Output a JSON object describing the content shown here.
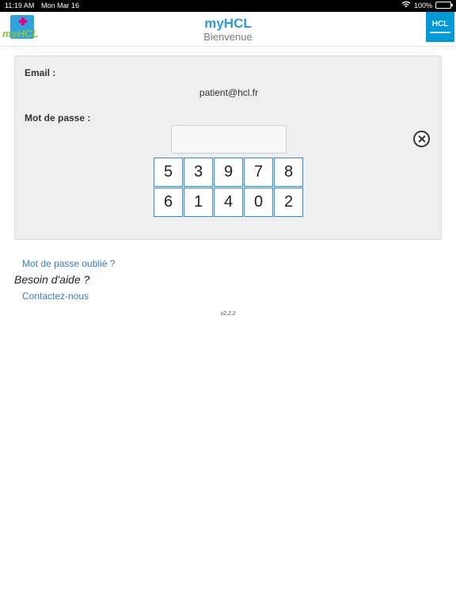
{
  "status": {
    "time": "11:19 AM",
    "date": "Mon Mar 16",
    "battery": "100%"
  },
  "header": {
    "title": "myHCL",
    "subtitle": "Bienvenue",
    "logo_left": {
      "my": "my",
      "hcl": "HCL"
    },
    "logo_right": "HCL"
  },
  "form": {
    "email_label": "Email :",
    "email_value": "patient@hcl.fr",
    "password_label": "Mot de passe :",
    "password_value": "",
    "keypad_row1": [
      "5",
      "3",
      "9",
      "7",
      "8"
    ],
    "keypad_row2": [
      "6",
      "1",
      "4",
      "0",
      "2"
    ]
  },
  "links": {
    "forgot": "Mot de passe oublié ?",
    "help": "Besoin d'aide ?",
    "contact": "Contactez-nous"
  },
  "version": "v2.2.2"
}
